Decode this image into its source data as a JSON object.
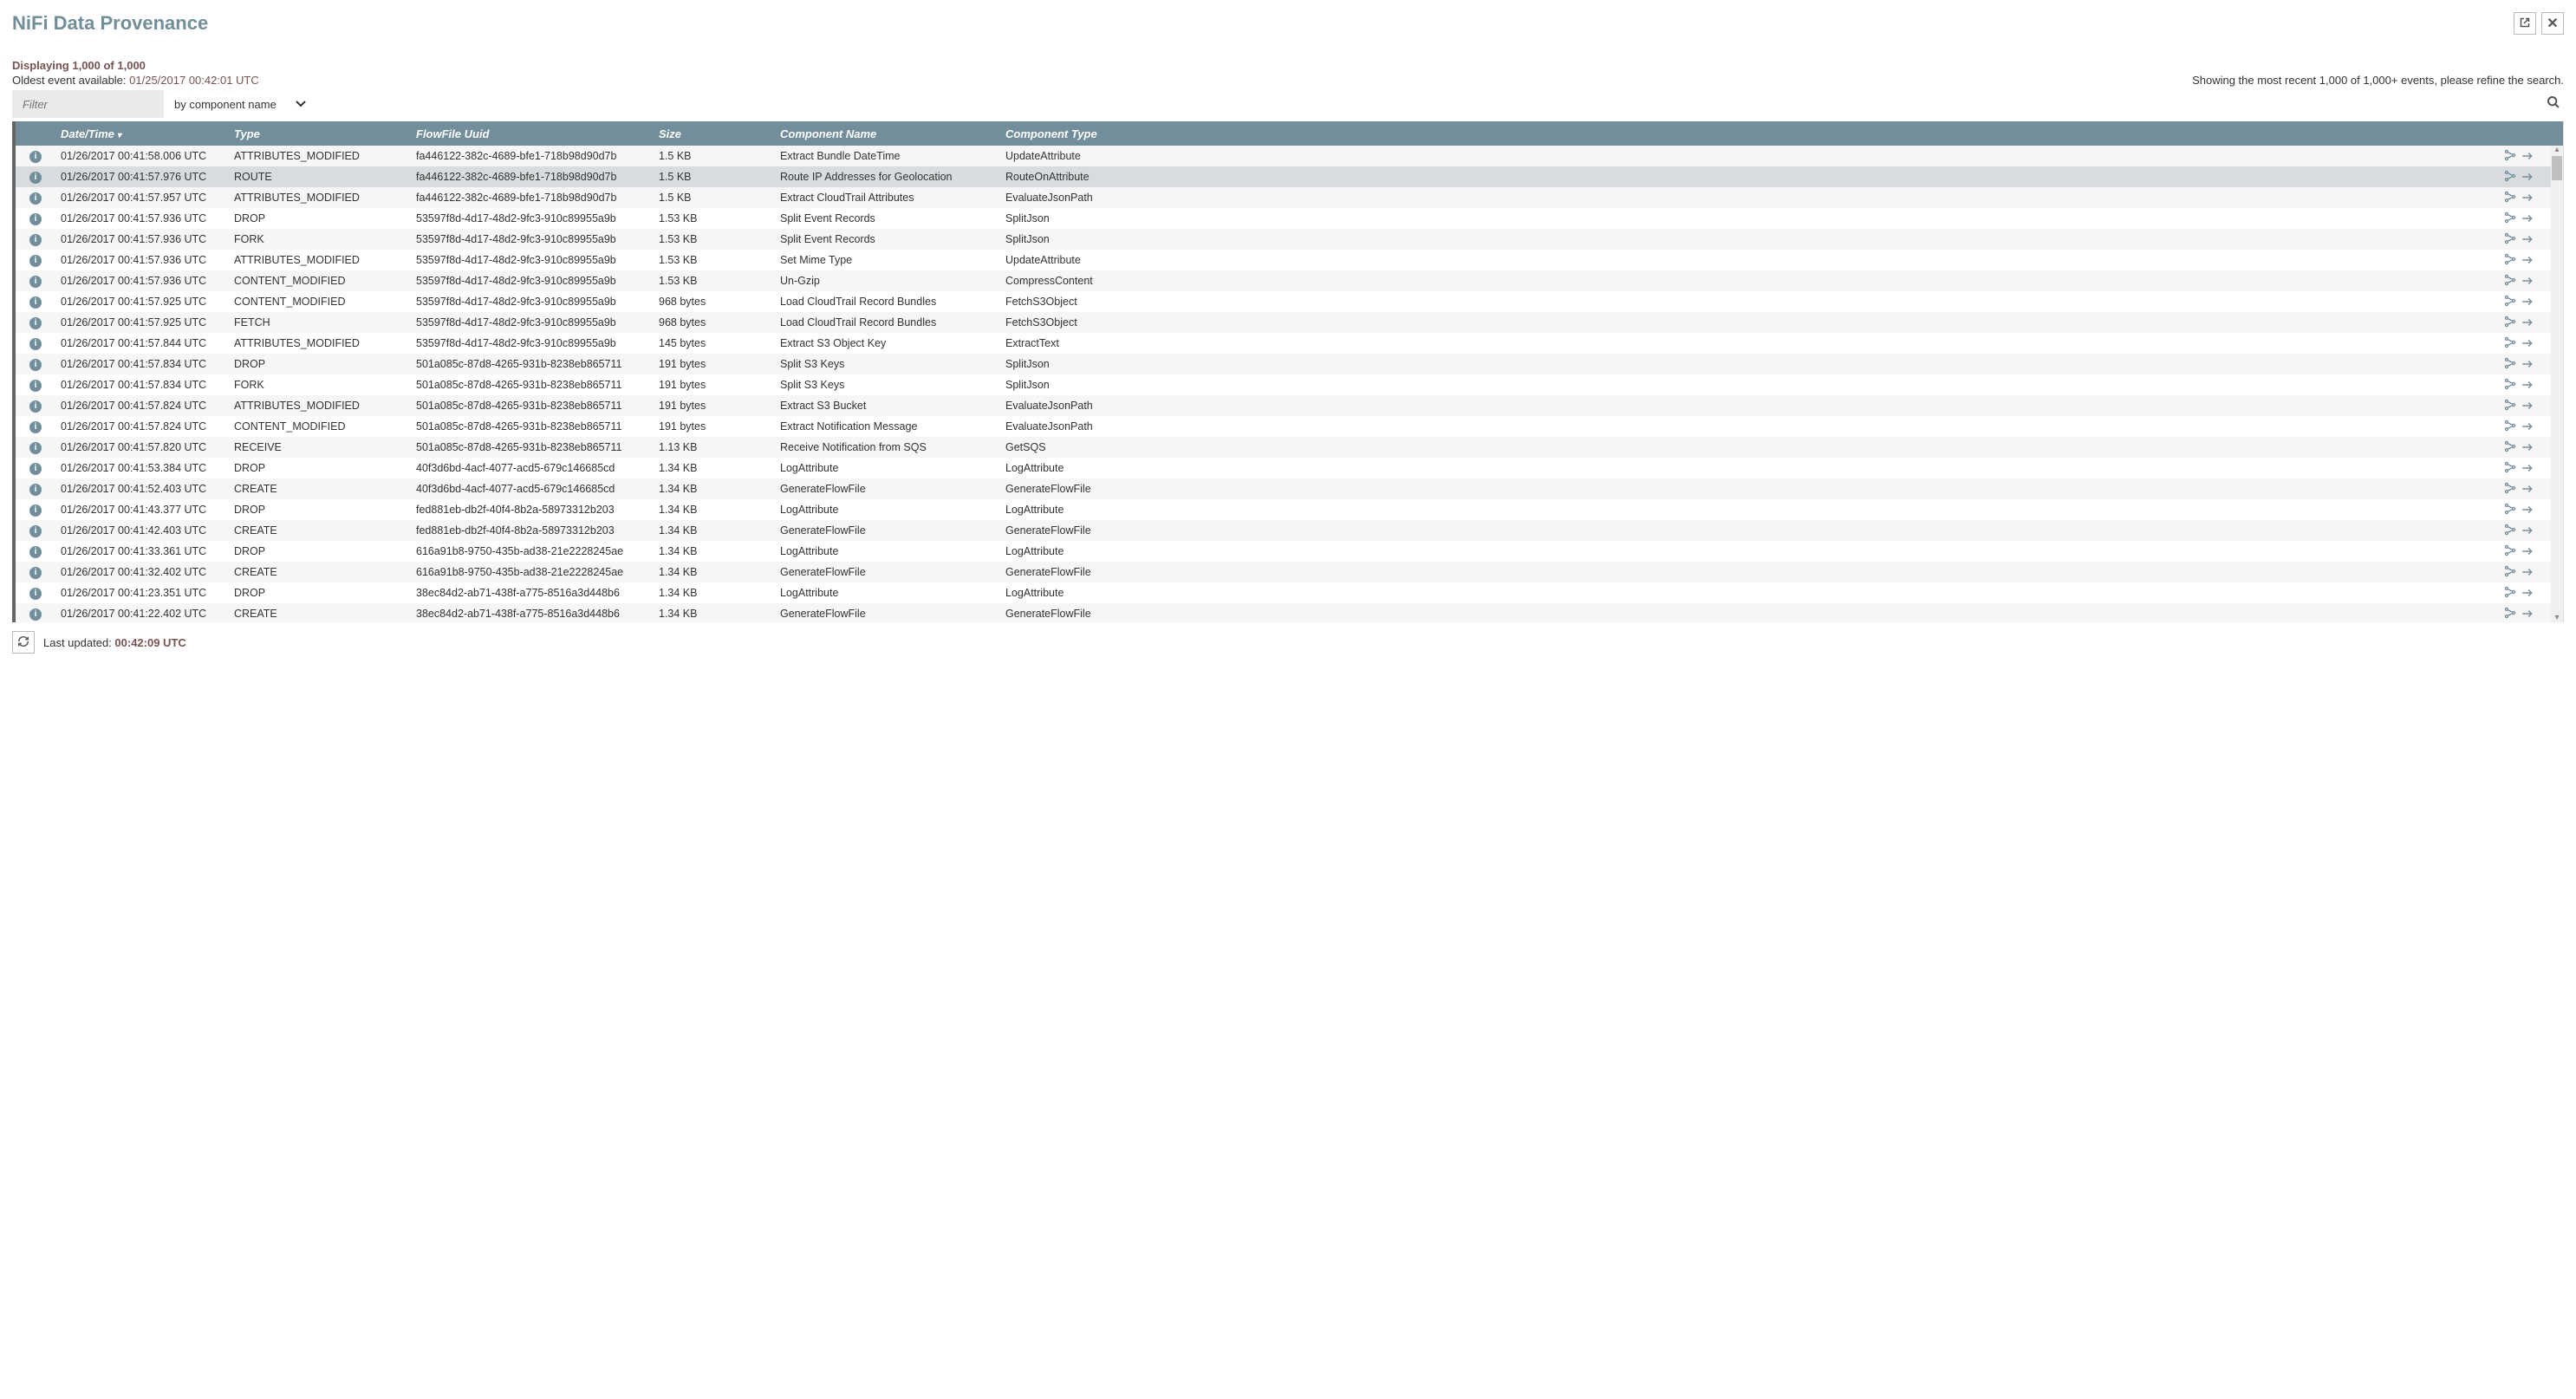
{
  "header": {
    "title": "NiFi Data Provenance"
  },
  "status": {
    "displaying": "Displaying 1,000 of 1,000",
    "oldest_label": "Oldest event available: ",
    "oldest_ts": "01/25/2017 00:42:01 UTC",
    "refine": "Showing the most recent 1,000 of 1,000+ events, please refine the search."
  },
  "filter": {
    "placeholder": "Filter",
    "mode": "by component name"
  },
  "columns": {
    "datetime": "Date/Time",
    "type": "Type",
    "uuid": "FlowFile Uuid",
    "size": "Size",
    "cname": "Component Name",
    "ctype": "Component Type"
  },
  "footer": {
    "label": "Last updated: ",
    "ts": "00:42:09 UTC"
  },
  "hover_index": 1,
  "rows": [
    {
      "dt": "01/26/2017 00:41:58.006 UTC",
      "type": "ATTRIBUTES_MODIFIED",
      "uuid": "fa446122-382c-4689-bfe1-718b98d90d7b",
      "size": "1.5 KB",
      "cname": "Extract Bundle DateTime",
      "ctype": "UpdateAttribute"
    },
    {
      "dt": "01/26/2017 00:41:57.976 UTC",
      "type": "ROUTE",
      "uuid": "fa446122-382c-4689-bfe1-718b98d90d7b",
      "size": "1.5 KB",
      "cname": "Route IP Addresses for Geolocation",
      "ctype": "RouteOnAttribute"
    },
    {
      "dt": "01/26/2017 00:41:57.957 UTC",
      "type": "ATTRIBUTES_MODIFIED",
      "uuid": "fa446122-382c-4689-bfe1-718b98d90d7b",
      "size": "1.5 KB",
      "cname": "Extract CloudTrail Attributes",
      "ctype": "EvaluateJsonPath"
    },
    {
      "dt": "01/26/2017 00:41:57.936 UTC",
      "type": "DROP",
      "uuid": "53597f8d-4d17-48d2-9fc3-910c89955a9b",
      "size": "1.53 KB",
      "cname": "Split Event Records",
      "ctype": "SplitJson"
    },
    {
      "dt": "01/26/2017 00:41:57.936 UTC",
      "type": "FORK",
      "uuid": "53597f8d-4d17-48d2-9fc3-910c89955a9b",
      "size": "1.53 KB",
      "cname": "Split Event Records",
      "ctype": "SplitJson"
    },
    {
      "dt": "01/26/2017 00:41:57.936 UTC",
      "type": "ATTRIBUTES_MODIFIED",
      "uuid": "53597f8d-4d17-48d2-9fc3-910c89955a9b",
      "size": "1.53 KB",
      "cname": "Set Mime Type",
      "ctype": "UpdateAttribute"
    },
    {
      "dt": "01/26/2017 00:41:57.936 UTC",
      "type": "CONTENT_MODIFIED",
      "uuid": "53597f8d-4d17-48d2-9fc3-910c89955a9b",
      "size": "1.53 KB",
      "cname": "Un-Gzip",
      "ctype": "CompressContent"
    },
    {
      "dt": "01/26/2017 00:41:57.925 UTC",
      "type": "CONTENT_MODIFIED",
      "uuid": "53597f8d-4d17-48d2-9fc3-910c89955a9b",
      "size": "968 bytes",
      "cname": "Load CloudTrail Record Bundles",
      "ctype": "FetchS3Object"
    },
    {
      "dt": "01/26/2017 00:41:57.925 UTC",
      "type": "FETCH",
      "uuid": "53597f8d-4d17-48d2-9fc3-910c89955a9b",
      "size": "968 bytes",
      "cname": "Load CloudTrail Record Bundles",
      "ctype": "FetchS3Object"
    },
    {
      "dt": "01/26/2017 00:41:57.844 UTC",
      "type": "ATTRIBUTES_MODIFIED",
      "uuid": "53597f8d-4d17-48d2-9fc3-910c89955a9b",
      "size": "145 bytes",
      "cname": "Extract S3 Object Key",
      "ctype": "ExtractText"
    },
    {
      "dt": "01/26/2017 00:41:57.834 UTC",
      "type": "DROP",
      "uuid": "501a085c-87d8-4265-931b-8238eb865711",
      "size": "191 bytes",
      "cname": "Split S3 Keys",
      "ctype": "SplitJson"
    },
    {
      "dt": "01/26/2017 00:41:57.834 UTC",
      "type": "FORK",
      "uuid": "501a085c-87d8-4265-931b-8238eb865711",
      "size": "191 bytes",
      "cname": "Split S3 Keys",
      "ctype": "SplitJson"
    },
    {
      "dt": "01/26/2017 00:41:57.824 UTC",
      "type": "ATTRIBUTES_MODIFIED",
      "uuid": "501a085c-87d8-4265-931b-8238eb865711",
      "size": "191 bytes",
      "cname": "Extract S3 Bucket",
      "ctype": "EvaluateJsonPath"
    },
    {
      "dt": "01/26/2017 00:41:57.824 UTC",
      "type": "CONTENT_MODIFIED",
      "uuid": "501a085c-87d8-4265-931b-8238eb865711",
      "size": "191 bytes",
      "cname": "Extract Notification Message",
      "ctype": "EvaluateJsonPath"
    },
    {
      "dt": "01/26/2017 00:41:57.820 UTC",
      "type": "RECEIVE",
      "uuid": "501a085c-87d8-4265-931b-8238eb865711",
      "size": "1.13 KB",
      "cname": "Receive Notification from SQS",
      "ctype": "GetSQS"
    },
    {
      "dt": "01/26/2017 00:41:53.384 UTC",
      "type": "DROP",
      "uuid": "40f3d6bd-4acf-4077-acd5-679c146685cd",
      "size": "1.34 KB",
      "cname": "LogAttribute",
      "ctype": "LogAttribute"
    },
    {
      "dt": "01/26/2017 00:41:52.403 UTC",
      "type": "CREATE",
      "uuid": "40f3d6bd-4acf-4077-acd5-679c146685cd",
      "size": "1.34 KB",
      "cname": "GenerateFlowFile",
      "ctype": "GenerateFlowFile"
    },
    {
      "dt": "01/26/2017 00:41:43.377 UTC",
      "type": "DROP",
      "uuid": "fed881eb-db2f-40f4-8b2a-58973312b203",
      "size": "1.34 KB",
      "cname": "LogAttribute",
      "ctype": "LogAttribute"
    },
    {
      "dt": "01/26/2017 00:41:42.403 UTC",
      "type": "CREATE",
      "uuid": "fed881eb-db2f-40f4-8b2a-58973312b203",
      "size": "1.34 KB",
      "cname": "GenerateFlowFile",
      "ctype": "GenerateFlowFile"
    },
    {
      "dt": "01/26/2017 00:41:33.361 UTC",
      "type": "DROP",
      "uuid": "616a91b8-9750-435b-ad38-21e2228245ae",
      "size": "1.34 KB",
      "cname": "LogAttribute",
      "ctype": "LogAttribute"
    },
    {
      "dt": "01/26/2017 00:41:32.402 UTC",
      "type": "CREATE",
      "uuid": "616a91b8-9750-435b-ad38-21e2228245ae",
      "size": "1.34 KB",
      "cname": "GenerateFlowFile",
      "ctype": "GenerateFlowFile"
    },
    {
      "dt": "01/26/2017 00:41:23.351 UTC",
      "type": "DROP",
      "uuid": "38ec84d2-ab71-438f-a775-8516a3d448b6",
      "size": "1.34 KB",
      "cname": "LogAttribute",
      "ctype": "LogAttribute"
    },
    {
      "dt": "01/26/2017 00:41:22.402 UTC",
      "type": "CREATE",
      "uuid": "38ec84d2-ab71-438f-a775-8516a3d448b6",
      "size": "1.34 KB",
      "cname": "GenerateFlowFile",
      "ctype": "GenerateFlowFile"
    }
  ]
}
